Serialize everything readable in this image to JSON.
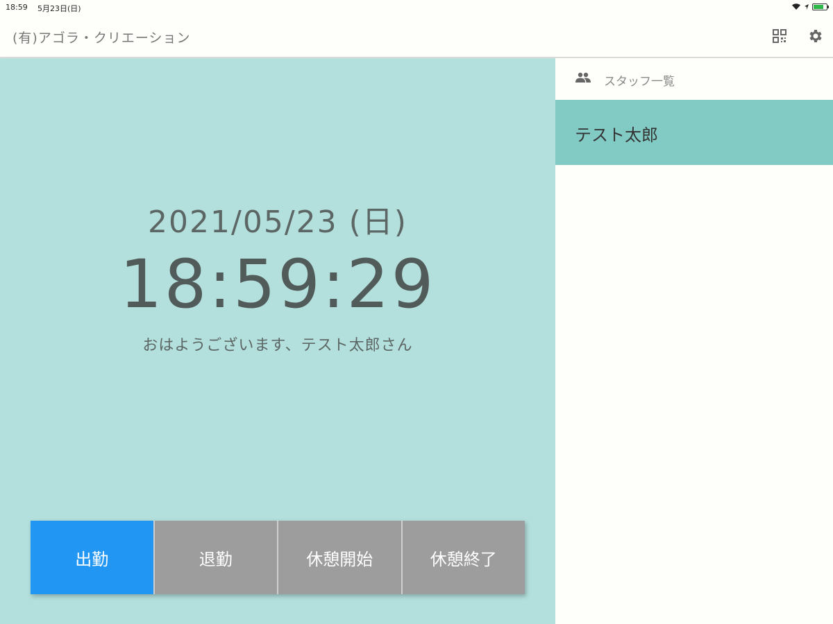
{
  "status_bar": {
    "time": "18:59",
    "date": "5月23日(日)"
  },
  "header": {
    "company_name": "(有)アゴラ・クリエーション",
    "icons": [
      "qr-code-icon",
      "gear-icon"
    ]
  },
  "main": {
    "date": "2021/05/23 (日)",
    "clock": "18:59:29",
    "greeting": "おはようございます、テスト太郎さん",
    "buttons": [
      {
        "label": "出勤",
        "active": true
      },
      {
        "label": "退勤",
        "active": false
      },
      {
        "label": "休憩開始",
        "active": false
      },
      {
        "label": "休憩終了",
        "active": false
      }
    ]
  },
  "sidebar": {
    "title": "スタッフ一覧",
    "icon": "people-icon",
    "staff": [
      {
        "name": "テスト太郎",
        "selected": true
      }
    ]
  },
  "colors": {
    "main_bg": "#b3dfdc",
    "selected_staff_bg": "#82cbc4",
    "active_button": "#2196f3",
    "inactive_button": "#9d9d9d"
  }
}
